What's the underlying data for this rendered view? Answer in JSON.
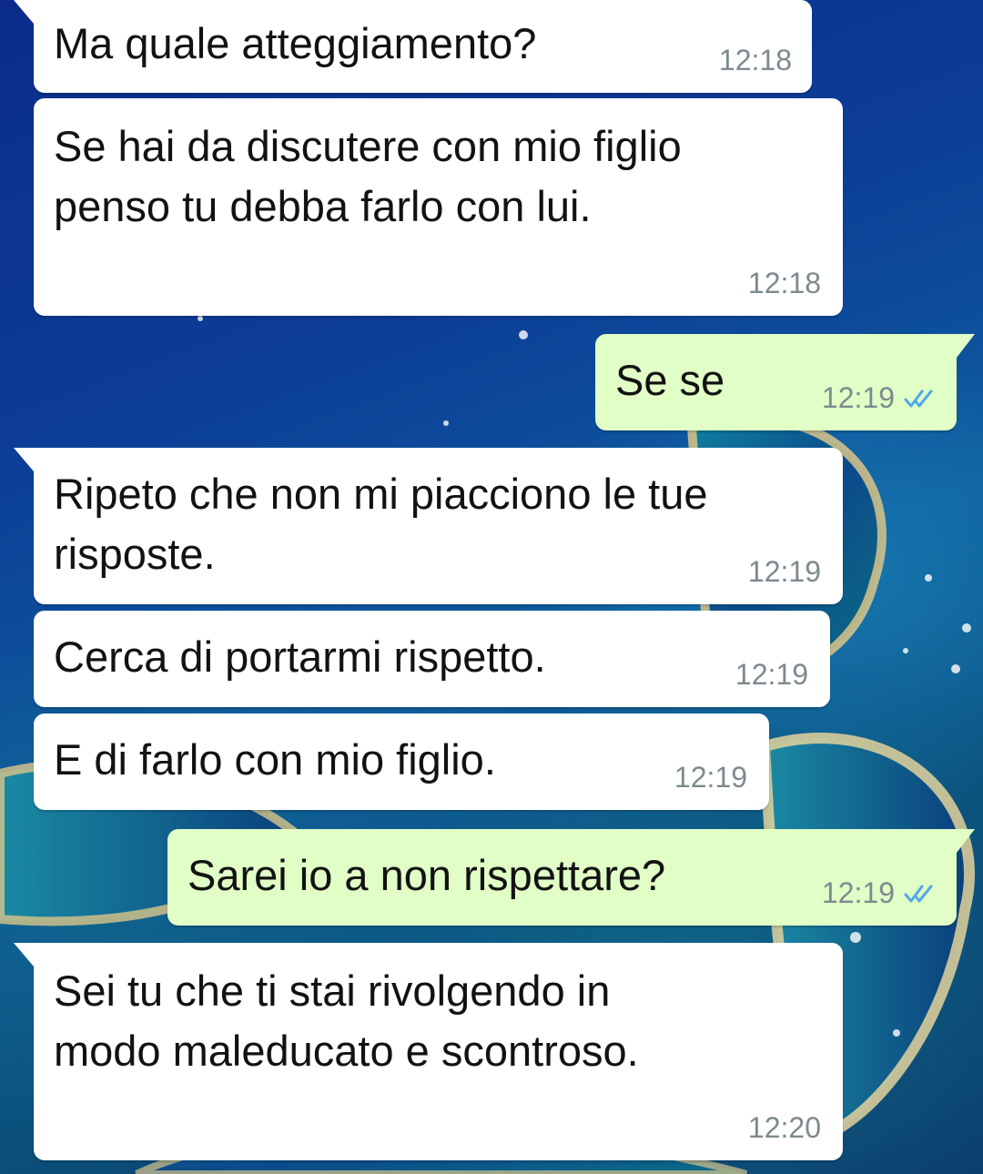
{
  "theme": {
    "incoming_bubble": "#ffffff",
    "outgoing_bubble": "#e1fec6",
    "text_color": "#121212",
    "time_color": "#7d8a8f",
    "read_tick_color": "#4fa8e8"
  },
  "messages": [
    {
      "direction": "incoming",
      "text": "Ma quale atteggiamento?",
      "time": "12:18"
    },
    {
      "direction": "incoming",
      "text": "Se hai da discutere con mio figlio\npenso tu debba farlo con lui.",
      "time": "12:18"
    },
    {
      "direction": "outgoing",
      "text": "Se se",
      "time": "12:19",
      "status_icon": "double-check-read-icon"
    },
    {
      "direction": "incoming",
      "text": "Ripeto che non mi piacciono le tue\nrisposte.",
      "time": "12:19"
    },
    {
      "direction": "incoming",
      "text": "Cerca di portarmi rispetto.",
      "time": "12:19"
    },
    {
      "direction": "incoming",
      "text": "E di farlo con mio figlio.",
      "time": "12:19"
    },
    {
      "direction": "outgoing",
      "text": "Sarei io a non rispettare?",
      "time": "12:19",
      "status_icon": "double-check-read-icon"
    },
    {
      "direction": "incoming",
      "text": "Sei tu che ti stai rivolgendo in\nmodo maleducato e scontroso.",
      "time": "12:20"
    }
  ]
}
